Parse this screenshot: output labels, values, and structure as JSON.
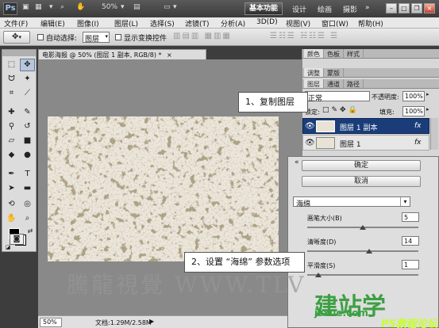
{
  "app": {
    "logo": "Ps",
    "zoom": "50%",
    "workspace_active": "基本功能",
    "workspaces": [
      "设计",
      "绘画",
      "摄影"
    ],
    "more": "»"
  },
  "menu": [
    "文件(F)",
    "编辑(E)",
    "图像(I)",
    "图层(L)",
    "选择(S)",
    "滤镜(T)",
    "分析(A)",
    "3D(D)",
    "视图(V)",
    "窗口(W)",
    "帮助(H)"
  ],
  "options": {
    "auto_select_label": "自动选择:",
    "auto_select_value": "图层",
    "show_transform_label": "显示变换控件"
  },
  "document": {
    "tab_title": "电影海报 @ 50% (图层 1 副本, RGB/8) *",
    "close": "×",
    "zoom": "50%",
    "doc_size": "文档:1.29M/2.58M"
  },
  "panels": {
    "tabs_row1": [
      "颜色",
      "色板",
      "样式"
    ],
    "tabs_row2": [
      "调整",
      "蒙版"
    ],
    "tabs_row3": [
      "图层",
      "通道",
      "路径"
    ],
    "blend_mode": "正常",
    "opacity_label": "不透明度:",
    "opacity_value": "100%",
    "lock_label": "锁定:",
    "fill_label": "填充:",
    "fill_value": "100%",
    "layers": [
      {
        "name": "图层 1 副本",
        "fx": "fx",
        "selected": true
      },
      {
        "name": "图层 1",
        "fx": "fx",
        "selected": false
      }
    ]
  },
  "filter": {
    "ok": "确定",
    "cancel": "取消",
    "filter_name": "海绵",
    "params": [
      {
        "label": "画笔大小(B)",
        "value": "5",
        "fraction": 0.5
      },
      {
        "label": "清晰度(D)",
        "value": "14",
        "fraction": 0.56
      },
      {
        "label": "平滑度(S)",
        "value": "1",
        "fraction": 0.1
      }
    ]
  },
  "callouts": {
    "step1": "1、复制图层",
    "step2": "2、设置 “海绵” 参数选项"
  },
  "watermarks": {
    "left": "騰龍視覺 WWW.TLV",
    "right_big": "建站学",
    "right_url": "jzxue.com",
    "corner": "PS教程论坛"
  },
  "colors": {
    "appbar": "#3b3b3b",
    "selection": "#1a3d7a",
    "panel_bg": "#d7d7d7",
    "canvas_bg": "#898989",
    "watermark_green": "#3da043"
  }
}
